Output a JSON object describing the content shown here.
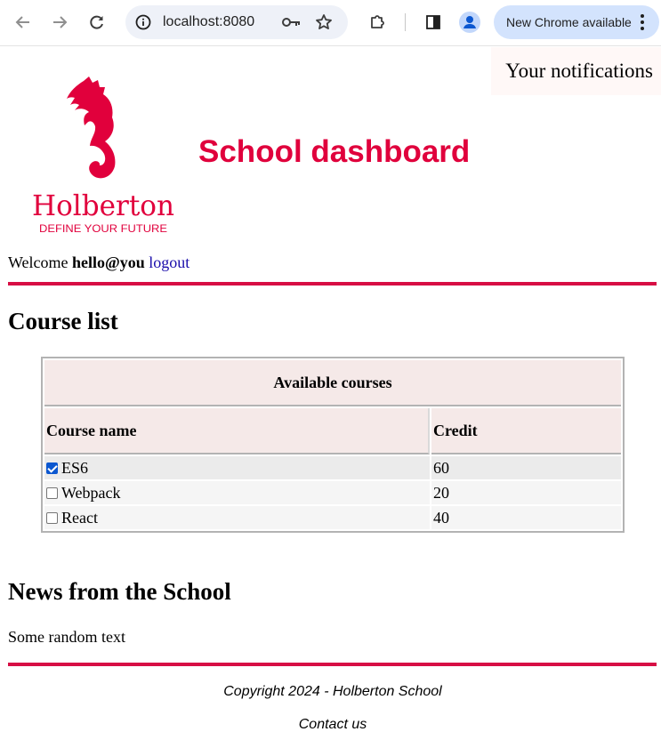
{
  "browser": {
    "url": "localhost:8080",
    "update_label": "New Chrome available"
  },
  "notifications": {
    "label": "Your notifications"
  },
  "header": {
    "logo_text": "Holberton",
    "logo_tagline": "DEFINE YOUR FUTURE",
    "title": "School dashboard"
  },
  "login": {
    "welcome": "Welcome",
    "email": "hello@you",
    "logout_label": "logout"
  },
  "course_list": {
    "heading": "Course list",
    "caption": "Available courses",
    "columns": [
      "Course name",
      "Credit"
    ],
    "rows": [
      {
        "name": "ES6",
        "credit": "60",
        "checked": true
      },
      {
        "name": "Webpack",
        "credit": "20",
        "checked": false
      },
      {
        "name": "React",
        "credit": "40",
        "checked": false
      }
    ]
  },
  "news": {
    "heading": "News from the School",
    "body": "Some random text"
  },
  "footer": {
    "copyright": "Copyright 2024 - Holberton School",
    "contact": "Contact us"
  },
  "colors": {
    "brand": "#e0003c",
    "rule": "#d70e44",
    "table_header_bg": "#f5e9e8",
    "chrome_pill": "#d3e3fd"
  }
}
